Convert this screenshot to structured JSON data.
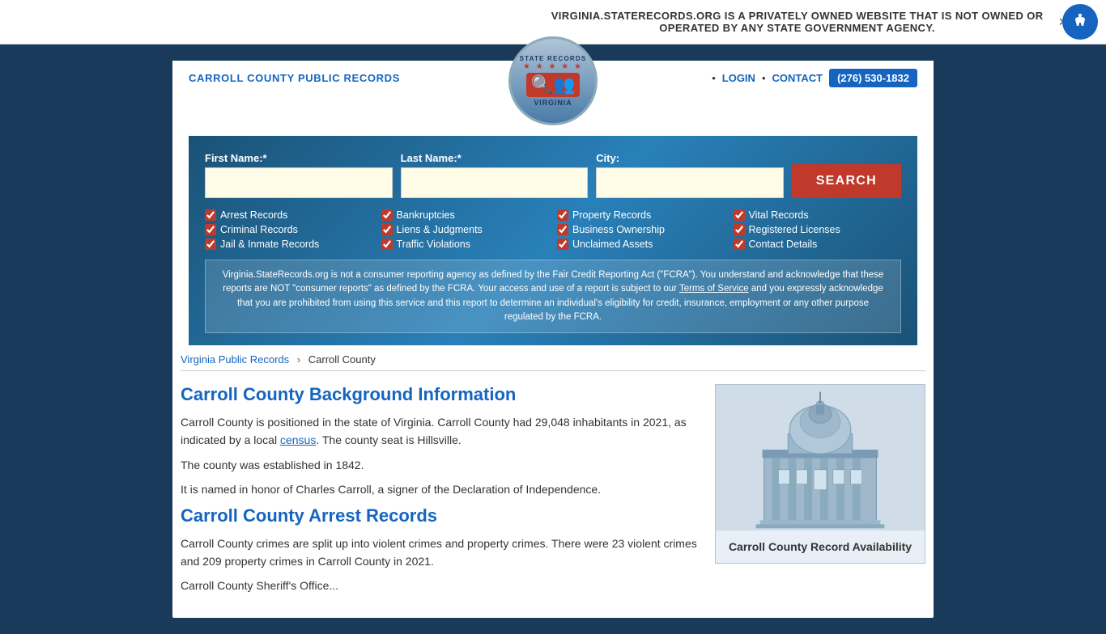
{
  "banner": {
    "text": "VIRGINIA.STATERECORDS.ORG IS A PRIVATELY OWNED WEBSITE THAT IS NOT OWNED OR OPERATED BY ANY STATE GOVERNMENT AGENCY.",
    "close_label": "×"
  },
  "header": {
    "site_title": "CARROLL COUNTY PUBLIC RECORDS",
    "logo": {
      "top_text": "STATE RECORDS",
      "stars": "★ ★ ★ ★ ★",
      "bottom_text": "VIRGINIA"
    },
    "nav": {
      "dot": "•",
      "login": "LOGIN",
      "contact": "CONTACT",
      "phone": "(276) 530-1832"
    }
  },
  "search": {
    "first_name_label": "First Name:*",
    "last_name_label": "Last Name:*",
    "city_label": "City:",
    "first_name_placeholder": "",
    "last_name_placeholder": "",
    "city_placeholder": "",
    "button_label": "SEARCH"
  },
  "checkboxes": [
    {
      "label": "Arrest Records",
      "checked": true
    },
    {
      "label": "Bankruptcies",
      "checked": true
    },
    {
      "label": "Property Records",
      "checked": true
    },
    {
      "label": "Vital Records",
      "checked": true
    },
    {
      "label": "Criminal Records",
      "checked": true
    },
    {
      "label": "Liens & Judgments",
      "checked": true
    },
    {
      "label": "Business Ownership",
      "checked": true
    },
    {
      "label": "Registered Licenses",
      "checked": true
    },
    {
      "label": "Jail & Inmate Records",
      "checked": true
    },
    {
      "label": "Traffic Violations",
      "checked": true
    },
    {
      "label": "Unclaimed Assets",
      "checked": true
    },
    {
      "label": "Contact Details",
      "checked": true
    }
  ],
  "disclaimer": {
    "text_before": "Virginia.StateRecords.org is not a consumer reporting agency as defined by the Fair Credit Reporting Act (\"FCRA\"). You understand and acknowledge that these reports are NOT \"consumer reports\" as defined by the FCRA. Your access and use of a report is subject to our ",
    "link_text": "Terms of Service",
    "text_after": " and you expressly acknowledge that you are prohibited from using this service and this report to determine an individual's eligibility for credit, insurance, employment or any other purpose regulated by the FCRA."
  },
  "breadcrumb": {
    "parent_label": "Virginia Public Records",
    "current_label": "Carroll County"
  },
  "content": {
    "bg_title": "Carroll County Background Information",
    "bg_text1": "Carroll County is positioned in the state of Virginia. Carroll County had 29,048 inhabitants in 2021, as indicated by a local ",
    "bg_census_link": "census",
    "bg_text2": ". The county seat is Hillsville.",
    "bg_text3": "The county was established in 1842.",
    "bg_text4": "It is named in honor of Charles Carroll, a signer of the Declaration of Independence.",
    "arrest_title": "Carroll County Arrest Records",
    "arrest_text1": "Carroll County crimes are split up into violent crimes and property crimes. There were 23 violent crimes and 209 property crimes in Carroll County in 2021.",
    "arrest_text2": "Carroll County Sheriff's Office..."
  },
  "sidebar": {
    "card_title": "Carroll County Record Availability"
  }
}
